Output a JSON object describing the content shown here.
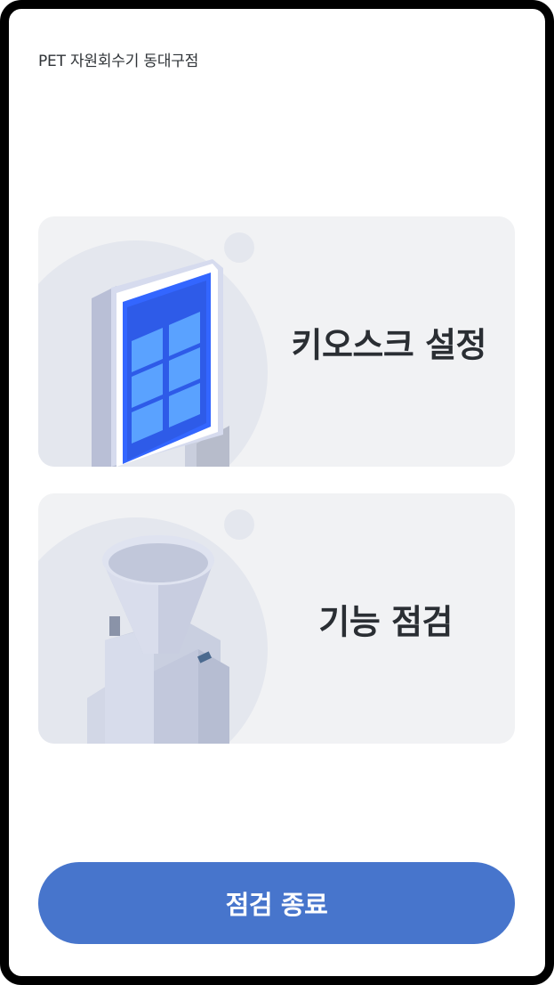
{
  "header": {
    "title": "PET 자원회수기 동대구점"
  },
  "menu": {
    "kiosk_settings": {
      "label": "키오스크 설정",
      "icon": "kiosk-screen-icon"
    },
    "function_check": {
      "label": "기능 점검",
      "icon": "recycling-machine-icon"
    }
  },
  "footer": {
    "end_check_label": "점검 종료"
  },
  "colors": {
    "primary_button": "#4775cc",
    "card_background": "#f1f2f4",
    "kiosk_screen": "#3366ff"
  }
}
